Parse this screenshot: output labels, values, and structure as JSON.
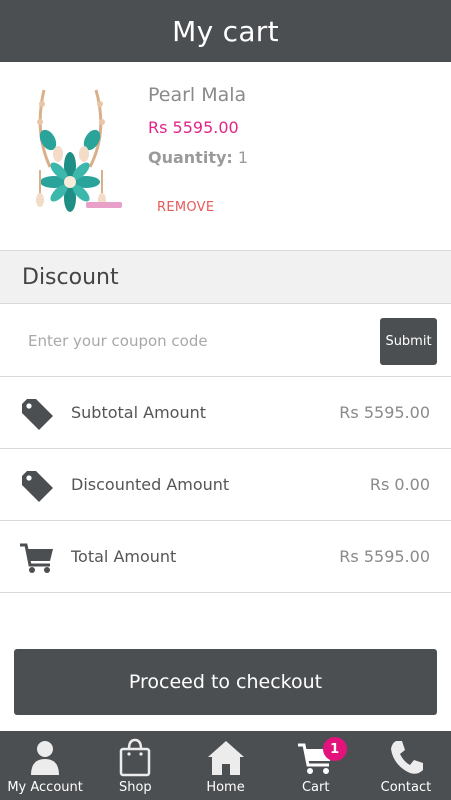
{
  "header": {
    "title": "My cart"
  },
  "cart_item": {
    "name": "Pearl Mala",
    "price": "Rs 5595.00",
    "quantity_label": "Quantity:",
    "quantity_value": "1",
    "remove_label": "REMOVE",
    "image_icon": "pearl-necklace-product-image"
  },
  "discount": {
    "heading": "Discount",
    "coupon_placeholder": "Enter your coupon code",
    "coupon_value": "",
    "submit_label": "Submit"
  },
  "summary": {
    "subtotal_label": "Subtotal Amount",
    "subtotal_value": "Rs 5595.00",
    "subtotal_icon": "price-tag-icon",
    "discounted_label": "Discounted Amount",
    "discounted_value": "Rs 0.00",
    "discounted_icon": "price-tag-icon",
    "total_label": "Total Amount",
    "total_value": "Rs 5595.00",
    "total_icon": "shopping-cart-icon"
  },
  "checkout": {
    "label": "Proceed to checkout"
  },
  "tabbar": {
    "items": [
      {
        "label": "My Account",
        "icon": "user-icon",
        "active": false
      },
      {
        "label": "Shop",
        "icon": "shopping-bag-icon",
        "active": false
      },
      {
        "label": "Home",
        "icon": "home-icon",
        "active": false
      },
      {
        "label": "Cart",
        "icon": "cart-icon",
        "active": true,
        "badge": "1"
      },
      {
        "label": "Contact",
        "icon": "phone-icon",
        "active": false
      }
    ]
  },
  "colors": {
    "bar": "#4b4f52",
    "price": "#e2248a",
    "remove": "#e65a5a",
    "badge": "#e2137a"
  }
}
